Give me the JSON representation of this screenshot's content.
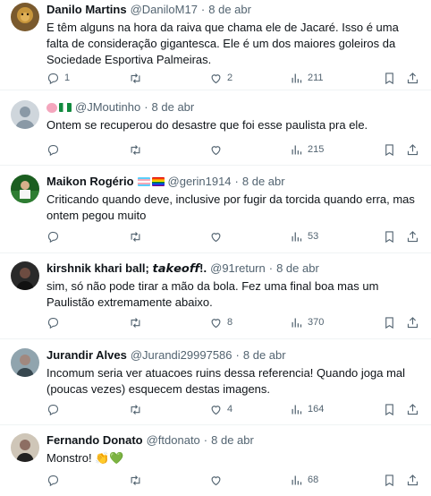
{
  "tweets": [
    {
      "name": "Danilo Martins",
      "handle": "@DaniloM17",
      "dot": "·",
      "date": "8 de abr",
      "text": "E têm alguns na hora da raiva que chama ele de Jacaré. Isso é uma falta de consideração gigantesca. Ele é um dos maiores goleiros da Sociedade Esportiva Palmeiras.",
      "replies": "1",
      "retweets": "",
      "likes": "2",
      "views": "211"
    },
    {
      "name": "",
      "handle": "@JMoutinho",
      "dot": "·",
      "date": "8 de abr",
      "text": "Ontem se recuperou do desastre que foi esse paulista pra ele.",
      "replies": "",
      "retweets": "",
      "likes": "",
      "views": "215"
    },
    {
      "name": "Maikon Rogério",
      "handle": "@gerin1914",
      "dot": "·",
      "date": "8 de abr",
      "text": "Criticando quando deve, inclusive por fugir da torcida quando erra, mas ontem pegou muito",
      "replies": "",
      "retweets": "",
      "likes": "",
      "views": "53"
    },
    {
      "name": "kirshnik khari ball; 𝙩𝙖𝙠𝙚𝙤𝙛𝙛!.",
      "handle": "@91return",
      "dot": "·",
      "date": "8 de abr",
      "text": "sim, só não pode tirar a mão da bola. Fez uma final boa mas um Paulistão extremamente abaixo.",
      "replies": "",
      "retweets": "",
      "likes": "8",
      "views": "370"
    },
    {
      "name": "Jurandir Alves",
      "handle": "@Jurandi29997586",
      "dot": "·",
      "date": "8 de abr",
      "text": "Incomum seria ver atuacoes ruins dessa referencia! Quando joga mal (poucas vezes) esquecem destas imagens.",
      "replies": "",
      "retweets": "",
      "likes": "4",
      "views": "164"
    },
    {
      "name": "Fernando Donato",
      "handle": "@ftdonato",
      "dot": "·",
      "date": "8 de abr",
      "text": "Monstro! 👏💚",
      "replies": "",
      "retweets": "",
      "likes": "",
      "views": "68"
    }
  ],
  "icons": {
    "reply": "reply-icon",
    "retweet": "retweet-icon",
    "like": "like-icon",
    "views": "views-icon",
    "bookmark": "bookmark-icon",
    "share": "share-icon"
  },
  "colors": {
    "text": "#0f1419",
    "secondary": "#536471",
    "divider": "#eff3f4"
  }
}
